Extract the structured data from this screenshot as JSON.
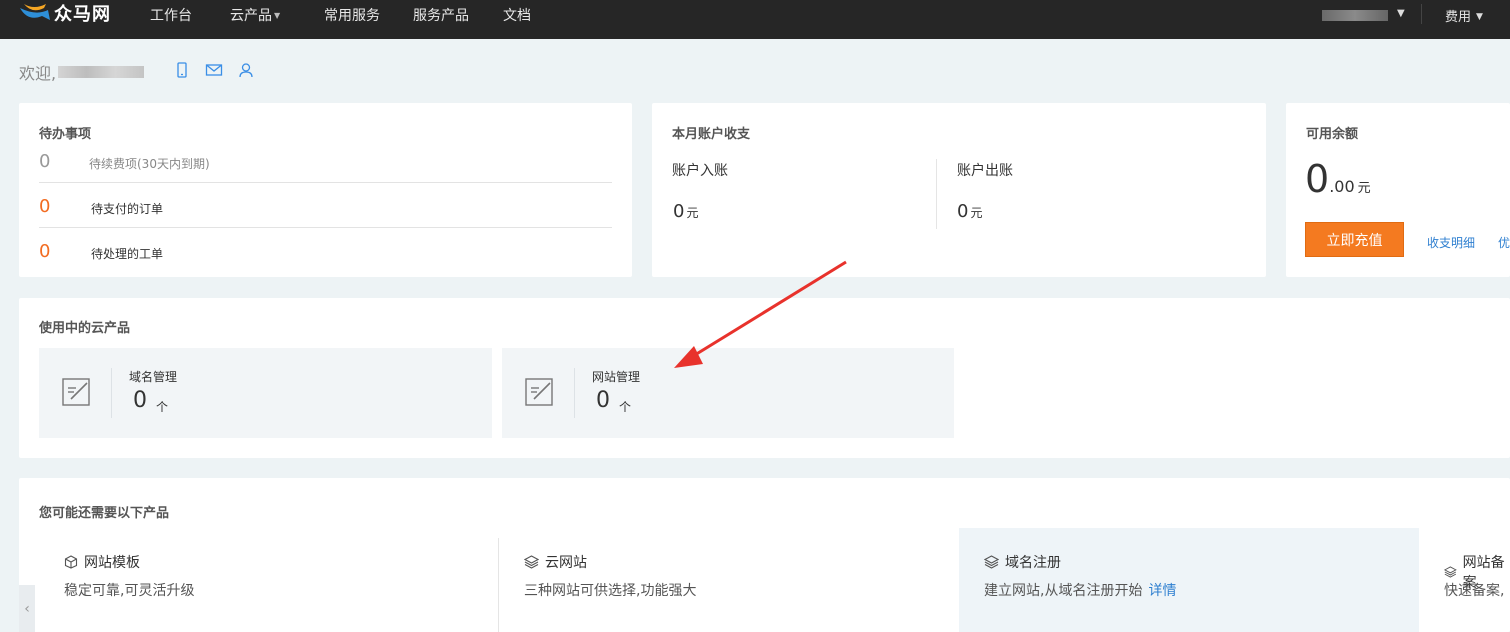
{
  "topbar": {
    "logo_text": "众马网",
    "nav": [
      {
        "label": "工作台"
      },
      {
        "label": "云产品"
      },
      {
        "label": "常用服务"
      },
      {
        "label": "服务产品"
      },
      {
        "label": "文档"
      }
    ],
    "fee_label": "费用"
  },
  "welcome": {
    "greeting": "欢迎,"
  },
  "todo": {
    "title": "待办事项",
    "rows": [
      {
        "count": "0",
        "label": "待续费项(30天内到期)"
      },
      {
        "count": "0",
        "label": "待支付的订单"
      },
      {
        "count": "0",
        "label": "待处理的工单"
      }
    ]
  },
  "account": {
    "title": "本月账户收支",
    "income_label": "账户入账",
    "income_value": "0",
    "expense_label": "账户出账",
    "expense_value": "0",
    "unit": "元"
  },
  "balance": {
    "title": "可用余额",
    "integer": "0",
    "cents": ".00",
    "unit": "元",
    "recharge_label": "立即充值",
    "detail_link": "收支明细",
    "coupon_link": "优"
  },
  "products_in_use": {
    "title": "使用中的云产品",
    "items": [
      {
        "name": "域名管理",
        "count": "0",
        "unit": "个"
      },
      {
        "name": "网站管理",
        "count": "0",
        "unit": "个"
      }
    ]
  },
  "recommend": {
    "title": "您可能还需要以下产品",
    "items": [
      {
        "title": "网站模板",
        "desc": "稳定可靠,可灵活升级"
      },
      {
        "title": "云网站",
        "desc": "三种网站可供选择,功能强大"
      },
      {
        "title": "域名注册",
        "desc": "建立网站,从域名注册开始",
        "detail": "详情"
      },
      {
        "title": "网站备案",
        "desc": "快速备案,"
      }
    ]
  },
  "colors": {
    "topbar_bg": "#262626",
    "accent_orange": "#f47a20",
    "link_blue": "#2e7fd0",
    "page_bg": "#edf3f5",
    "annotation_red": "#e8322c"
  }
}
